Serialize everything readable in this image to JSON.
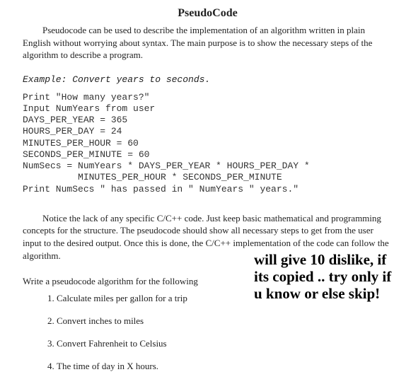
{
  "title": "PseudoCode",
  "intro": "Pseudocode can be used to describe the implementation of an algorithm written in plain English without worrying about syntax.  The main purpose is to show the necessary steps of the algorithm to describe a program.",
  "example_label": "Example: Convert years to seconds.",
  "code": "Print \"How many years?\"\nInput NumYears from user\nDAYS_PER_YEAR = 365\nHOURS_PER_DAY = 24\nMINUTES_PER_HOUR = 60\nSECONDS_PER_MINUTE = 60\nNumSecs = NumYears * DAYS_PER_YEAR * HOURS_PER_DAY *\n          MINUTES_PER_HOUR * SECONDS_PER_MINUTE\nPrint NumSecs \" has passed in \" NumYears \" years.\"",
  "explain": "Notice the lack of any specific C/C++ code.  Just keep basic mathematical and programming concepts for the structure.   The pseudocode should show all necessary steps to get from the user input to the desired output.  Once this is done, the C/C++ implementation of the code can follow the algorithm.",
  "prompt": "Write a pseudocode algorithm for the following",
  "tasks": [
    "Calculate miles per gallon for a trip",
    "Convert inches to miles",
    "Convert Fahrenheit to Celsius",
    "The time of day in X hours."
  ],
  "overlay_note": "will give 10 dislike, if its copied .. try only if u know or else skip!"
}
